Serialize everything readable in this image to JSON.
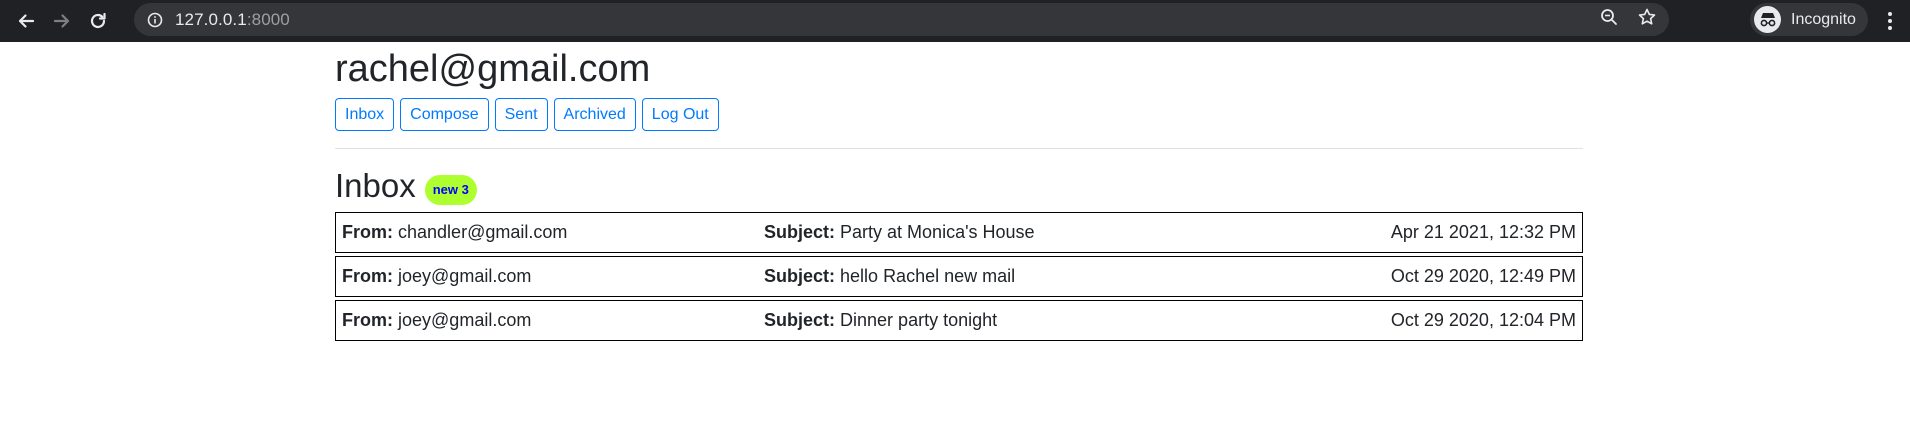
{
  "browser": {
    "url_host": "127.0.0.1",
    "url_port": ":8000",
    "profile_label": "Incognito",
    "icons": [
      "back-arrow-icon",
      "forward-arrow-icon",
      "reload-icon",
      "info-icon",
      "zoom-icon",
      "star-icon",
      "incognito-icon",
      "menu-icon"
    ]
  },
  "header": {
    "email": "rachel@gmail.com"
  },
  "nav": {
    "inbox": "Inbox",
    "compose": "Compose",
    "sent": "Sent",
    "archived": "Archived",
    "logout": "Log Out"
  },
  "mailbox": {
    "title": "Inbox",
    "badge": "new 3",
    "from_label": "From:",
    "subject_label": "Subject:",
    "emails": [
      {
        "from": "chandler@gmail.com",
        "subject": "Party at Monica's House",
        "timestamp": "Apr 21 2021, 12:32 PM"
      },
      {
        "from": "joey@gmail.com",
        "subject": "hello Rachel new mail",
        "timestamp": "Oct 29 2020, 12:49 PM"
      },
      {
        "from": "joey@gmail.com",
        "subject": "Dinner party tonight",
        "timestamp": "Oct 29 2020, 12:04 PM"
      }
    ]
  },
  "colors": {
    "chrome_bg": "#202124",
    "omnibox_bg": "#35363a",
    "button_blue": "#007bff",
    "badge_bg": "#adff2f",
    "badge_text": "#0000ff"
  }
}
